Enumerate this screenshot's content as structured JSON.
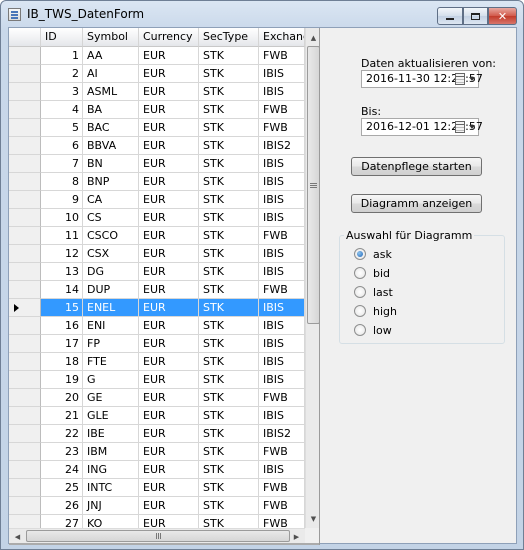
{
  "window": {
    "title": "IB_TWS_DatenForm"
  },
  "grid": {
    "columns": [
      "ID",
      "Symbol",
      "Currency",
      "SecType",
      "Exchange"
    ],
    "selected_index": 14,
    "rows": [
      {
        "id": "1",
        "symbol": "AA",
        "currency": "EUR",
        "sectype": "STK",
        "exchange": "FWB"
      },
      {
        "id": "2",
        "symbol": "AI",
        "currency": "EUR",
        "sectype": "STK",
        "exchange": "IBIS"
      },
      {
        "id": "3",
        "symbol": "ASML",
        "currency": "EUR",
        "sectype": "STK",
        "exchange": "IBIS"
      },
      {
        "id": "4",
        "symbol": "BA",
        "currency": "EUR",
        "sectype": "STK",
        "exchange": "FWB"
      },
      {
        "id": "5",
        "symbol": "BAC",
        "currency": "EUR",
        "sectype": "STK",
        "exchange": "FWB"
      },
      {
        "id": "6",
        "symbol": "BBVA",
        "currency": "EUR",
        "sectype": "STK",
        "exchange": "IBIS2"
      },
      {
        "id": "7",
        "symbol": "BN",
        "currency": "EUR",
        "sectype": "STK",
        "exchange": "IBIS"
      },
      {
        "id": "8",
        "symbol": "BNP",
        "currency": "EUR",
        "sectype": "STK",
        "exchange": "IBIS"
      },
      {
        "id": "9",
        "symbol": "CA",
        "currency": "EUR",
        "sectype": "STK",
        "exchange": "IBIS"
      },
      {
        "id": "10",
        "symbol": "CS",
        "currency": "EUR",
        "sectype": "STK",
        "exchange": "IBIS"
      },
      {
        "id": "11",
        "symbol": "CSCO",
        "currency": "EUR",
        "sectype": "STK",
        "exchange": "FWB"
      },
      {
        "id": "12",
        "symbol": "CSX",
        "currency": "EUR",
        "sectype": "STK",
        "exchange": "IBIS"
      },
      {
        "id": "13",
        "symbol": "DG",
        "currency": "EUR",
        "sectype": "STK",
        "exchange": "IBIS"
      },
      {
        "id": "14",
        "symbol": "DUP",
        "currency": "EUR",
        "sectype": "STK",
        "exchange": "FWB"
      },
      {
        "id": "15",
        "symbol": "ENEL",
        "currency": "EUR",
        "sectype": "STK",
        "exchange": "IBIS"
      },
      {
        "id": "16",
        "symbol": "ENI",
        "currency": "EUR",
        "sectype": "STK",
        "exchange": "IBIS"
      },
      {
        "id": "17",
        "symbol": "FP",
        "currency": "EUR",
        "sectype": "STK",
        "exchange": "IBIS"
      },
      {
        "id": "18",
        "symbol": "FTE",
        "currency": "EUR",
        "sectype": "STK",
        "exchange": "IBIS"
      },
      {
        "id": "19",
        "symbol": "G",
        "currency": "EUR",
        "sectype": "STK",
        "exchange": "IBIS"
      },
      {
        "id": "20",
        "symbol": "GE",
        "currency": "EUR",
        "sectype": "STK",
        "exchange": "FWB"
      },
      {
        "id": "21",
        "symbol": "GLE",
        "currency": "EUR",
        "sectype": "STK",
        "exchange": "IBIS"
      },
      {
        "id": "22",
        "symbol": "IBE",
        "currency": "EUR",
        "sectype": "STK",
        "exchange": "IBIS2"
      },
      {
        "id": "23",
        "symbol": "IBM",
        "currency": "EUR",
        "sectype": "STK",
        "exchange": "FWB"
      },
      {
        "id": "24",
        "symbol": "ING",
        "currency": "EUR",
        "sectype": "STK",
        "exchange": "IBIS"
      },
      {
        "id": "25",
        "symbol": "INTC",
        "currency": "EUR",
        "sectype": "STK",
        "exchange": "FWB"
      },
      {
        "id": "26",
        "symbol": "JNJ",
        "currency": "EUR",
        "sectype": "STK",
        "exchange": "FWB"
      },
      {
        "id": "27",
        "symbol": "KO",
        "currency": "EUR",
        "sectype": "STK",
        "exchange": "FWB"
      }
    ]
  },
  "panel": {
    "from_label": "Daten aktualisieren von:",
    "from_value": "2016-11-30 12:23:57",
    "to_label": "Bis:",
    "to_value": "2016-12-01 12:23:57",
    "btn_update": "Datenpflege starten",
    "btn_chart": "Diagramm anzeigen",
    "group_title": "Auswahl für Diagramm",
    "radios": [
      {
        "label": "ask",
        "checked": true
      },
      {
        "label": "bid",
        "checked": false
      },
      {
        "label": "last",
        "checked": false
      },
      {
        "label": "high",
        "checked": false
      },
      {
        "label": "low",
        "checked": false
      }
    ]
  },
  "icons": {
    "app": "form-icon",
    "minimize": "minimize-icon",
    "maximize": "maximize-icon",
    "close": "close-icon",
    "row_pointer": "row-pointer-icon",
    "calendar": "calendar-icon"
  },
  "colors": {
    "selection": "#3399ff",
    "title_gradient": "#c9d8ea",
    "client_bg": "#f0f0f0"
  }
}
